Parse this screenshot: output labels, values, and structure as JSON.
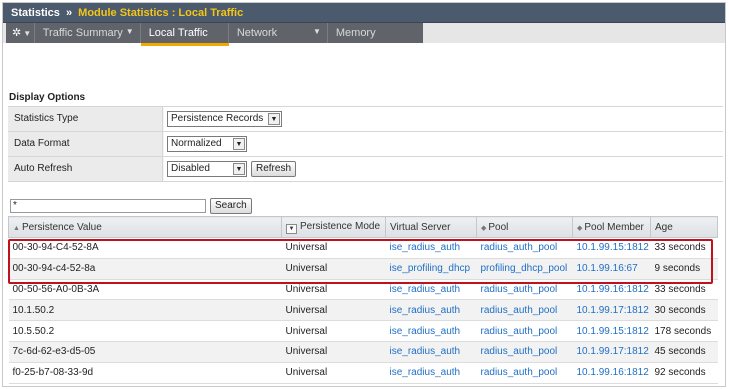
{
  "titlebar": {
    "root": "Statistics",
    "separator": "»",
    "crumb": "Module Statistics : Local Traffic"
  },
  "tabs": [
    {
      "label": "",
      "icon": "gear-icon"
    },
    {
      "label": "Traffic Summary"
    },
    {
      "label": "Local Traffic",
      "active": true
    },
    {
      "label": "Network"
    },
    {
      "label": "Memory"
    }
  ],
  "display_options": {
    "title": "Display Options",
    "statistics_type": {
      "label": "Statistics Type",
      "value": "Persistence Records"
    },
    "data_format": {
      "label": "Data Format",
      "value": "Normalized"
    },
    "auto_refresh": {
      "label": "Auto Refresh",
      "value": "Disabled",
      "button": "Refresh"
    }
  },
  "search": {
    "value": "*",
    "button": "Search"
  },
  "table": {
    "columns": [
      "Persistence Value",
      "Persistence Mode",
      "Virtual Server",
      "Pool",
      "Pool Member",
      "Age"
    ],
    "rows": [
      [
        "00-30-94-C4-52-8A",
        "Universal",
        "ise_radius_auth",
        "radius_auth_pool",
        "10.1.99.15:1812",
        "33 seconds"
      ],
      [
        "00-30-94-c4-52-8a",
        "Universal",
        "ise_profiling_dhcp",
        "profiling_dhcp_pool",
        "10.1.99.16:67",
        "9 seconds"
      ],
      [
        "00-50-56-A0-0B-3A",
        "Universal",
        "ise_radius_auth",
        "radius_auth_pool",
        "10.1.99.16:1812",
        "33 seconds"
      ],
      [
        "10.1.50.2",
        "Universal",
        "ise_radius_auth",
        "radius_auth_pool",
        "10.1.99.17:1812",
        "30 seconds"
      ],
      [
        "10.5.50.2",
        "Universal",
        "ise_radius_auth",
        "radius_auth_pool",
        "10.1.99.15:1812",
        "178 seconds"
      ],
      [
        "7c-6d-62-e3-d5-05",
        "Universal",
        "ise_radius_auth",
        "radius_auth_pool",
        "10.1.99.17:1812",
        "45 seconds"
      ],
      [
        "f0-25-b7-08-33-9d",
        "Universal",
        "ise_radius_auth",
        "radius_auth_pool",
        "10.1.99.16:1812",
        "92 seconds"
      ]
    ]
  },
  "colors": {
    "accent": "#f5a800",
    "header": "#4b5a6c",
    "link": "#1f6fc5",
    "highlight_box": "#c0121c"
  }
}
